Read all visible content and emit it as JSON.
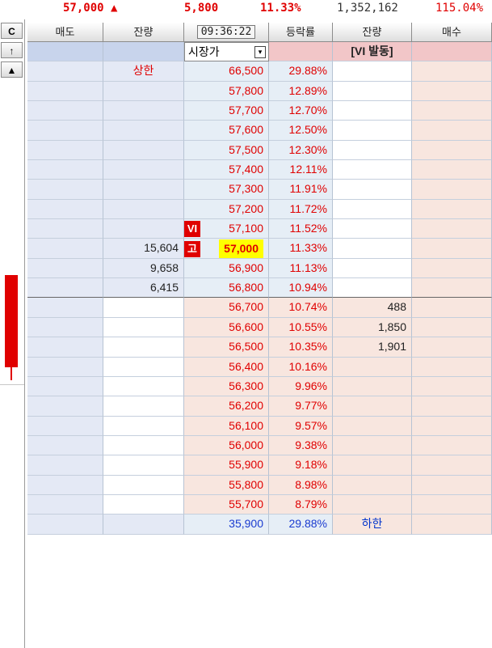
{
  "summary": {
    "price": "57,000 ▲",
    "change": "5,800",
    "rate": "11.33%",
    "volume": "1,352,162",
    "ratio": "115.04%"
  },
  "strip": {
    "btn_c": "C",
    "btn_up": "↑",
    "btn_tri": "▲"
  },
  "header": {
    "sell": "매도",
    "sell_qty": "잔량",
    "time": "09:36:22",
    "rate": "등락률",
    "buy_qty": "잔량",
    "buy": "매수"
  },
  "top_row": {
    "select_value": "시장가",
    "dropdown_icon": "▾",
    "vi_label": "[VI 발동]"
  },
  "asks": [
    {
      "qty": "상한",
      "price": "66,500",
      "rate": "29.88%",
      "badge": ""
    },
    {
      "qty": "",
      "price": "57,800",
      "rate": "12.89%",
      "badge": ""
    },
    {
      "qty": "",
      "price": "57,700",
      "rate": "12.70%",
      "badge": ""
    },
    {
      "qty": "",
      "price": "57,600",
      "rate": "12.50%",
      "badge": ""
    },
    {
      "qty": "",
      "price": "57,500",
      "rate": "12.30%",
      "badge": ""
    },
    {
      "qty": "",
      "price": "57,400",
      "rate": "12.11%",
      "badge": ""
    },
    {
      "qty": "",
      "price": "57,300",
      "rate": "11.91%",
      "badge": ""
    },
    {
      "qty": "",
      "price": "57,200",
      "rate": "11.72%",
      "badge": ""
    },
    {
      "qty": "",
      "price": "57,100",
      "rate": "11.52%",
      "badge": "VI"
    },
    {
      "qty": "15,604",
      "price": "57,000",
      "rate": "11.33%",
      "badge": "고"
    },
    {
      "qty": "9,658",
      "price": "56,900",
      "rate": "11.13%",
      "badge": ""
    },
    {
      "qty": "6,415",
      "price": "56,800",
      "rate": "10.94%",
      "badge": ""
    }
  ],
  "bids": [
    {
      "price": "56,700",
      "rate": "10.74%",
      "qty": "488"
    },
    {
      "price": "56,600",
      "rate": "10.55%",
      "qty": "1,850"
    },
    {
      "price": "56,500",
      "rate": "10.35%",
      "qty": "1,901"
    },
    {
      "price": "56,400",
      "rate": "10.16%",
      "qty": ""
    },
    {
      "price": "56,300",
      "rate": "9.96%",
      "qty": ""
    },
    {
      "price": "56,200",
      "rate": "9.77%",
      "qty": ""
    },
    {
      "price": "56,100",
      "rate": "9.57%",
      "qty": ""
    },
    {
      "price": "56,000",
      "rate": "9.38%",
      "qty": ""
    },
    {
      "price": "55,900",
      "rate": "9.18%",
      "qty": ""
    },
    {
      "price": "55,800",
      "rate": "8.98%",
      "qty": ""
    },
    {
      "price": "55,700",
      "rate": "8.79%",
      "qty": ""
    }
  ],
  "bottom_row": {
    "price": "35,900",
    "rate": "29.88%",
    "label": "하한"
  },
  "colors": {
    "up": "#e00000",
    "down": "#1a3bd0",
    "current_highlight": "#ffff00"
  }
}
